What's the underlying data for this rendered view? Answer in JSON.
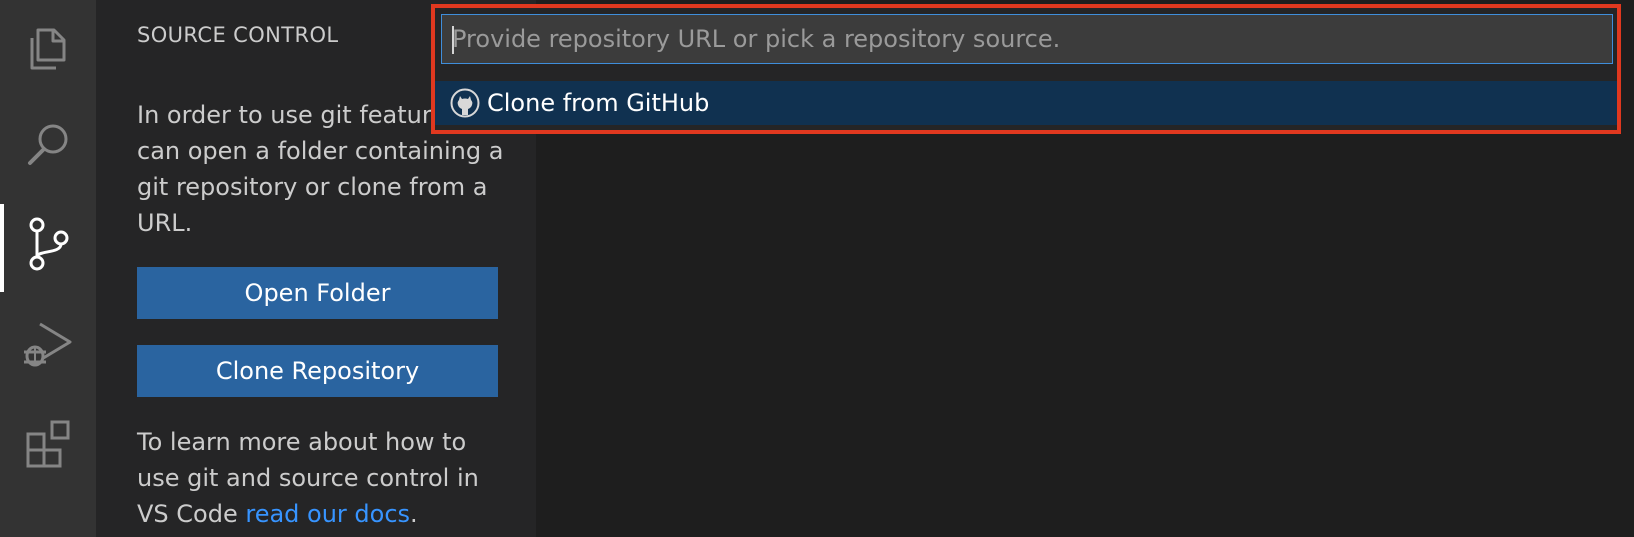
{
  "activity_bar": {
    "items": [
      {
        "name": "explorer",
        "icon": "files-icon"
      },
      {
        "name": "search",
        "icon": "search-icon"
      },
      {
        "name": "source-control",
        "icon": "source-control-icon",
        "active": true
      },
      {
        "name": "run-and-debug",
        "icon": "run-debug-icon"
      },
      {
        "name": "extensions",
        "icon": "extensions-icon"
      }
    ]
  },
  "sidebar": {
    "title": "SOURCE CONTROL",
    "intro_text": "In order to use git features, you can open a folder containing a git repository or clone from a URL.",
    "open_folder_label": "Open Folder",
    "clone_repository_label": "Clone Repository",
    "learn_text": "To learn more about how to use git and source control in VS Code ",
    "docs_link_label": "read our docs",
    "learn_text_end": "."
  },
  "quick_pick": {
    "input_placeholder": "Provide repository URL or pick a repository source.",
    "input_value": "",
    "items": [
      {
        "label": "Clone from GitHub",
        "icon": "github-icon"
      }
    ]
  },
  "colors": {
    "activity_bar_bg": "#333333",
    "sidebar_bg": "#252526",
    "editor_bg": "#1e1e1e",
    "button_bg": "#2a64a0",
    "link": "#3794ff",
    "highlight_border": "#e0381f",
    "input_focus_border": "#3f8edb",
    "selected_item_bg": "#103150"
  }
}
